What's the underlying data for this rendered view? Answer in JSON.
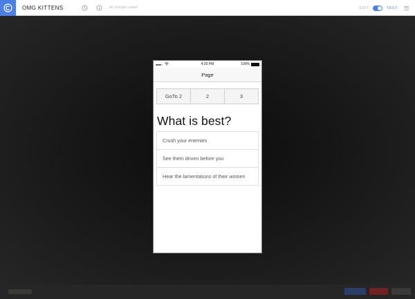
{
  "app": {
    "project_title": "OMG KITTENS",
    "save_status": "All changes saved",
    "logo_icon": "copyright-logo-icon",
    "accent_color": "#4a7fe8"
  },
  "toolbar": {
    "history_icon": "history-clock-icon",
    "info_icon": "info-icon",
    "mode_edit_label": "EDIT",
    "mode_test_label": "TEST",
    "mode_toggle_state": "test",
    "menu_icon": "hamburger-menu-icon"
  },
  "phone": {
    "status": {
      "signal": "●●●●○",
      "wifi_icon": "wifi-icon",
      "time": "4:20 PM",
      "battery": "100%",
      "battery_level": 1.0
    },
    "nav_title": "Page",
    "segments": [
      "GoTo 2",
      "2",
      "3"
    ],
    "question": "What is best?",
    "answers": [
      "Crush your enemies",
      "See them driven before you",
      "Hear the lamentations of their women"
    ]
  },
  "bottom_bar": {
    "buttons": [
      {
        "color": "#2b3e68"
      },
      {
        "color": "#6e2222"
      },
      {
        "color": "#3a3a3a"
      }
    ]
  }
}
